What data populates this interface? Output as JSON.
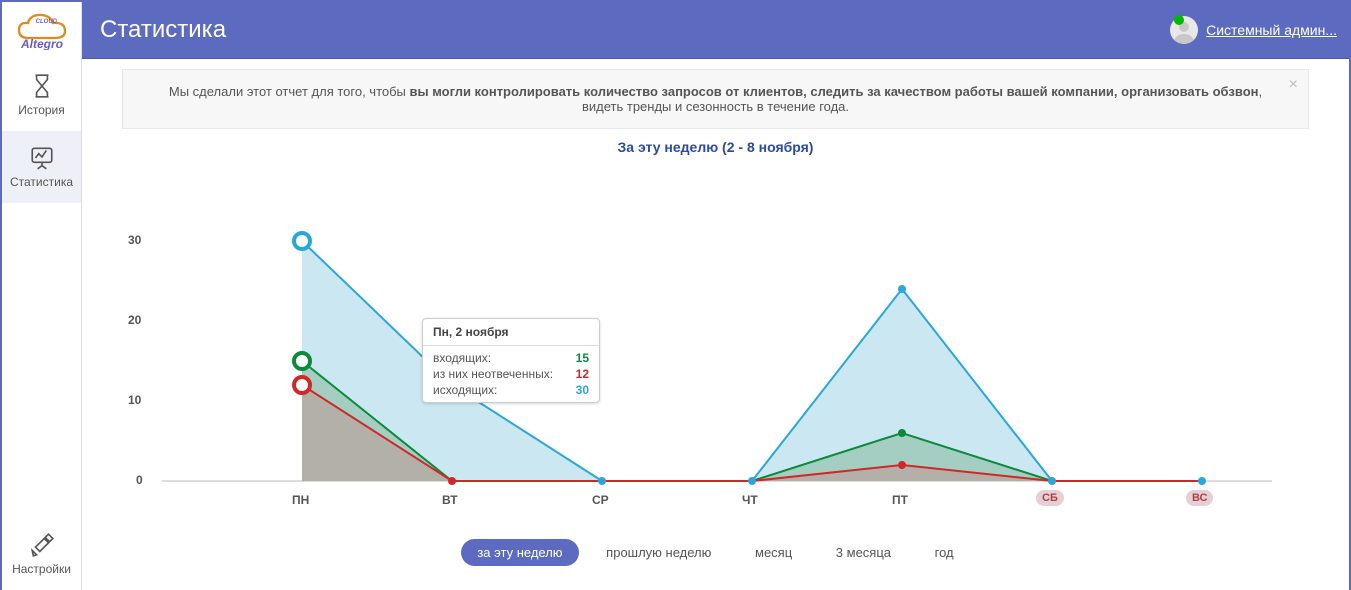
{
  "brand": "Altegro",
  "brand_sub": "CLOUD",
  "header": {
    "title": "Статистика"
  },
  "user": {
    "name": "Системный админ..."
  },
  "sidebar": {
    "history": "История",
    "stats": "Статистика",
    "settings": "Настройки"
  },
  "notice": {
    "pre": "Мы сделали этот отчет для того, чтобы ",
    "bold": "вы могли контролировать количество запросов от клиентов, следить за качеством работы вашей компании, организовать обзвон",
    "post": ", видеть тренды и сезонность в течение года."
  },
  "chart": {
    "title": "За эту неделю (2 - 8 ноября)"
  },
  "tooltip": {
    "header": "Пн, 2 ноября",
    "rows": {
      "in_label": "входящих:",
      "in_val": "15",
      "miss_label": "из них неотвеченных:",
      "miss_val": "12",
      "out_label": "исходящих:",
      "out_val": "30"
    }
  },
  "y_ticks": {
    "t0": "0",
    "t10": "10",
    "t20": "20",
    "t30": "30"
  },
  "days": {
    "mon": "ПН",
    "tue": "ВТ",
    "wed": "СР",
    "thu": "ЧТ",
    "fri": "ПТ",
    "sat": "СБ",
    "sun": "ВС"
  },
  "ranges": {
    "r0": "за эту неделю",
    "r1": "прошлую неделю",
    "r2": "месяц",
    "r3": "3 месяца",
    "r4": "год"
  },
  "chart_data": {
    "type": "area",
    "title": "За эту неделю (2 - 8 ноября)",
    "xlabel": "",
    "ylabel": "",
    "ylim": [
      0,
      30
    ],
    "categories": [
      "ПН",
      "ВТ",
      "СР",
      "ЧТ",
      "ПТ",
      "СБ",
      "ВС"
    ],
    "series": [
      {
        "name": "входящих",
        "color": "#0a8a3a",
        "values": [
          15,
          0,
          0,
          0,
          6,
          0,
          0
        ]
      },
      {
        "name": "из них неотвеченных",
        "color": "#d02828",
        "values": [
          12,
          0,
          0,
          0,
          2,
          0,
          0
        ]
      },
      {
        "name": "исходящих",
        "color": "#2aa7d9",
        "values": [
          30,
          12,
          0,
          0,
          24,
          0,
          0
        ]
      }
    ],
    "tooltip_point": {
      "category": "ПН",
      "date": "2 ноября",
      "входящих": 15,
      "из них неотвеченных": 12,
      "исходящих": 30
    }
  }
}
